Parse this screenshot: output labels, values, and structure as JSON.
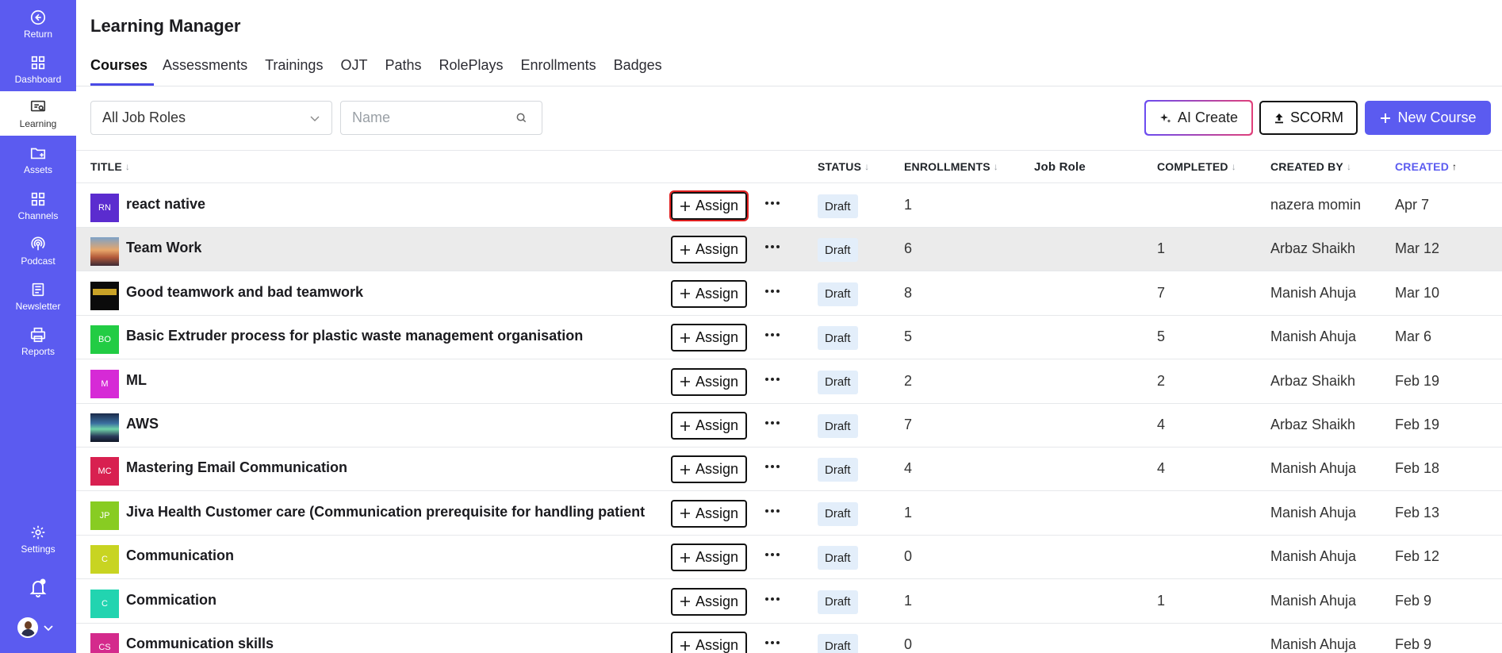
{
  "sidebar": {
    "items": [
      {
        "label": "Return",
        "icon": "return-icon"
      },
      {
        "label": "Dashboard",
        "icon": "dashboard-icon"
      },
      {
        "label": "Learning",
        "icon": "learning-icon",
        "active": true
      },
      {
        "label": "Assets",
        "icon": "assets-folder-icon"
      },
      {
        "label": "Channels",
        "icon": "channels-icon"
      },
      {
        "label": "Podcast",
        "icon": "podcast-icon"
      },
      {
        "label": "Newsletter",
        "icon": "newsletter-icon"
      },
      {
        "label": "Reports",
        "icon": "printer-icon"
      },
      {
        "label": "Settings",
        "icon": "gear-icon"
      }
    ],
    "accent": "#5b5bf0"
  },
  "header": {
    "title": "Learning Manager",
    "tabs": [
      {
        "label": "Courses",
        "active": true
      },
      {
        "label": "Assessments"
      },
      {
        "label": "Trainings"
      },
      {
        "label": "OJT"
      },
      {
        "label": "Paths"
      },
      {
        "label": "RolePlays"
      },
      {
        "label": "Enrollments"
      },
      {
        "label": "Badges"
      }
    ]
  },
  "filters": {
    "job_role": "All Job Roles",
    "name_placeholder": "Name"
  },
  "actions": {
    "ai_create": "AI Create",
    "scorm": "SCORM",
    "new_course": "New Course"
  },
  "table": {
    "columns": {
      "title": "TITLE",
      "status": "STATUS",
      "enrollments": "ENROLLMENTS",
      "job_role": "Job Role",
      "completed": "COMPLETED",
      "created_by": "CREATED BY",
      "created": "CREATED"
    },
    "assign_label": "Assign",
    "rows": [
      {
        "initials": "RN",
        "color": "#5b2ccf",
        "title": "react native",
        "status": "Draft",
        "enrollments": "1",
        "completed": "",
        "created_by": "nazera momin",
        "created": "Apr 7"
      },
      {
        "initials": "",
        "image": "sunset",
        "title": "Team Work",
        "status": "Draft",
        "enrollments": "6",
        "completed": "1",
        "created_by": "Arbaz Shaikh",
        "created": "Mar 12"
      },
      {
        "initials": "",
        "image": "dark-banner",
        "title": "Good teamwork and bad teamwork",
        "status": "Draft",
        "enrollments": "8",
        "completed": "7",
        "created_by": "Manish Ahuja",
        "created": "Mar 10"
      },
      {
        "initials": "BO",
        "color": "#22cc44",
        "title": "Basic Extruder process for plastic waste management organisation",
        "status": "Draft",
        "enrollments": "5",
        "completed": "5",
        "created_by": "Manish Ahuja",
        "created": "Mar 6"
      },
      {
        "initials": "M",
        "color": "#d62ad6",
        "title": "ML",
        "status": "Draft",
        "enrollments": "2",
        "completed": "2",
        "created_by": "Arbaz Shaikh",
        "created": "Feb 19"
      },
      {
        "initials": "",
        "image": "aurora",
        "title": "AWS",
        "status": "Draft",
        "enrollments": "7",
        "completed": "4",
        "created_by": "Arbaz Shaikh",
        "created": "Feb 19"
      },
      {
        "initials": "MC",
        "color": "#d82050",
        "title": "Mastering Email Communication",
        "status": "Draft",
        "enrollments": "4",
        "completed": "4",
        "created_by": "Manish Ahuja",
        "created": "Feb 18"
      },
      {
        "initials": "JP",
        "color": "#88cc22",
        "title": "Jiva Health Customer care (Communication prerequisite for handling patient",
        "status": "Draft",
        "enrollments": "1",
        "completed": "",
        "created_by": "Manish Ahuja",
        "created": "Feb 13"
      },
      {
        "initials": "C",
        "color": "#c8d422",
        "title": "Communication",
        "status": "Draft",
        "enrollments": "0",
        "completed": "",
        "created_by": "Manish Ahuja",
        "created": "Feb 12"
      },
      {
        "initials": "C",
        "color": "#22d4b0",
        "title": "Commication",
        "status": "Draft",
        "enrollments": "1",
        "completed": "1",
        "created_by": "Manish Ahuja",
        "created": "Feb 9"
      },
      {
        "initials": "CS",
        "color": "#d42a8c",
        "title": "Communication skills",
        "status": "Draft",
        "enrollments": "0",
        "completed": "",
        "created_by": "Manish Ahuja",
        "created": "Feb 9"
      }
    ]
  }
}
